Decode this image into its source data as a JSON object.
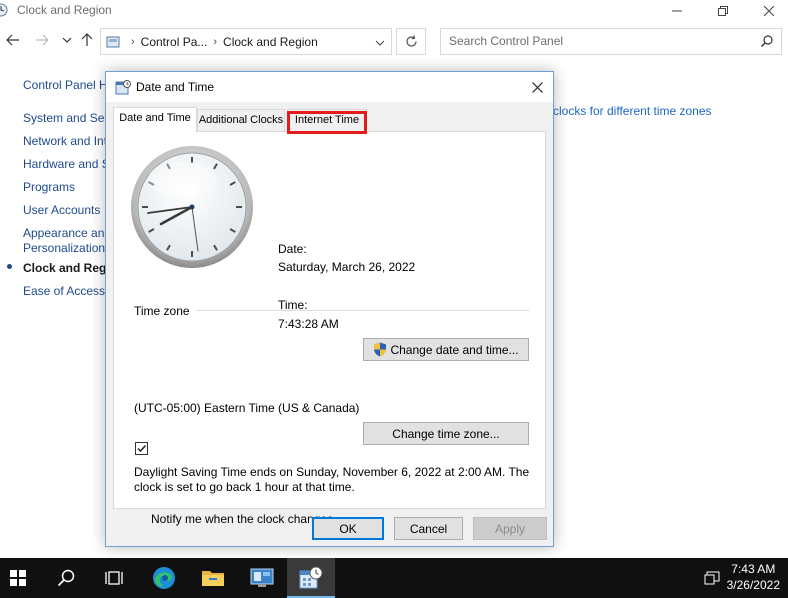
{
  "control_panel": {
    "window_title": "Clock and Region",
    "breadcrumb": [
      "Control Pa...",
      "Clock and Region"
    ],
    "search_placeholder": "Search Control Panel",
    "side_links": [
      {
        "label": "Control Panel H"
      },
      {
        "label": "System and Sec"
      },
      {
        "label": "Network and Int"
      },
      {
        "label": "Hardware and S"
      },
      {
        "label": "Programs"
      },
      {
        "label": "User Accounts"
      },
      {
        "label": "Appearance and"
      },
      {
        "label": "Personalization"
      },
      {
        "label": "Clock and Regio"
      },
      {
        "label": "Ease of Access"
      }
    ],
    "tz_link": "clocks for different time zones"
  },
  "dialog": {
    "title": "Date and Time",
    "tabs": [
      "Date and Time",
      "Additional Clocks",
      "Internet Time"
    ],
    "date_label": "Date:",
    "date_value": "Saturday, March 26, 2022",
    "time_label": "Time:",
    "time_value": "7:43:28 AM",
    "change_datetime_button": "Change date and time...",
    "timezone_group": "Time zone",
    "timezone_value": "(UTC-05:00) Eastern Time (US & Canada)",
    "change_timezone_button": "Change time zone...",
    "dst_line1": "Daylight Saving Time ends on Sunday, November 6, 2022 at 2:00 AM. The",
    "dst_line2": "clock is set to go back 1 hour at that time.",
    "notify_label": "Notify me when the clock changes",
    "notify_checked": true,
    "ok_button": "OK",
    "cancel_button": "Cancel",
    "apply_button": "Apply"
  },
  "taskbar": {
    "time": "7:43 AM",
    "date": "3/26/2022"
  },
  "colors": {
    "link": "#1e4a8c",
    "highlight": "#e41b1b",
    "taskbar": "#101010"
  }
}
